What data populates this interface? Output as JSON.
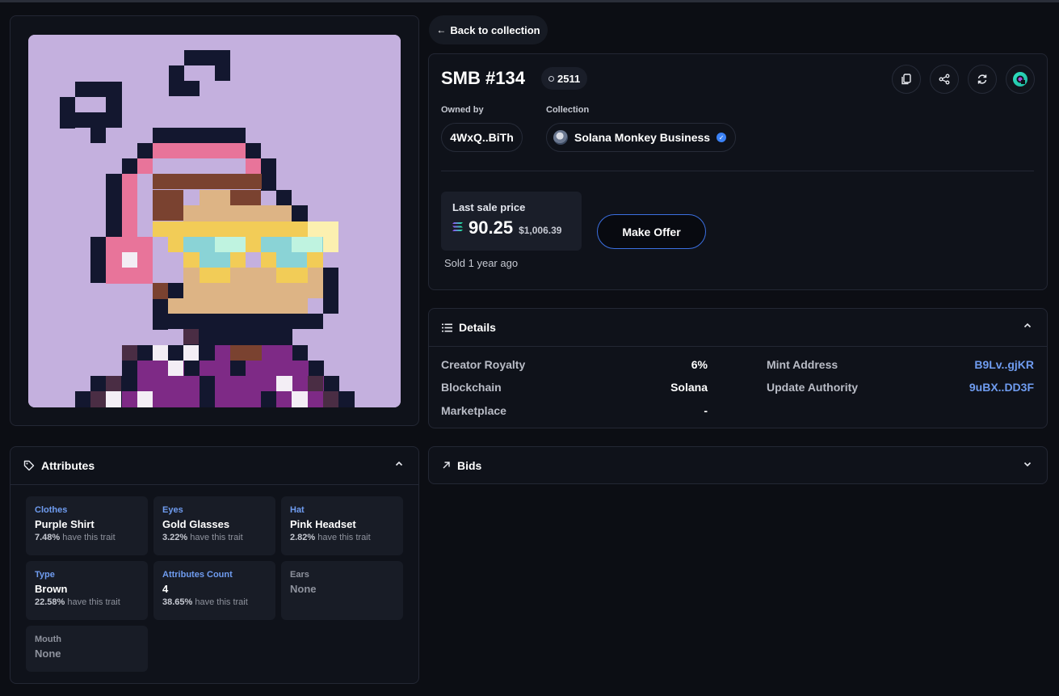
{
  "nav": {
    "back_label": "Back to collection"
  },
  "nft": {
    "title": "SMB #134",
    "rank": "2511",
    "owned_by_label": "Owned by",
    "owner": "4WxQ..BiTh",
    "collection_label": "Collection",
    "collection": "Solana Monkey Business",
    "last_sale_label": "Last sale price",
    "last_sale_price": "90.25",
    "last_sale_usd": "$1,006.39",
    "sold_time": "Sold 1 year ago",
    "make_offer_label": "Make Offer",
    "action_icons": [
      "copy-icon",
      "share-icon",
      "refresh-icon",
      "marketplace-logo-icon"
    ]
  },
  "details": {
    "title": "Details",
    "rows_left": [
      {
        "label": "Creator Royalty",
        "value": "6%"
      },
      {
        "label": "Blockchain",
        "value": "Solana"
      },
      {
        "label": "Marketplace",
        "value": "-"
      }
    ],
    "rows_right": [
      {
        "label": "Mint Address",
        "value": "B9Lv..gjKR"
      },
      {
        "label": "Update Authority",
        "value": "9uBX..DD3F"
      }
    ]
  },
  "bids": {
    "title": "Bids"
  },
  "attributes": {
    "title": "Attributes",
    "suffix": "have this trait",
    "items": [
      {
        "type": "Clothes",
        "value": "Purple Shirt",
        "pct": "7.48%"
      },
      {
        "type": "Eyes",
        "value": "Gold Glasses",
        "pct": "3.22%"
      },
      {
        "type": "Hat",
        "value": "Pink Headset",
        "pct": "2.82%"
      },
      {
        "type": "Type",
        "value": "Brown",
        "pct": "22.58%"
      },
      {
        "type": "Attributes Count",
        "value": "4",
        "pct": "38.65%"
      },
      {
        "type": "Ears",
        "value": "None"
      },
      {
        "type": "Mouth",
        "value": "None"
      }
    ]
  },
  "colors": {
    "background": "#0c0e14",
    "panel": "#0f121a",
    "accent_blue": "#6f9cf0",
    "nft_background": "#c4b0de"
  }
}
